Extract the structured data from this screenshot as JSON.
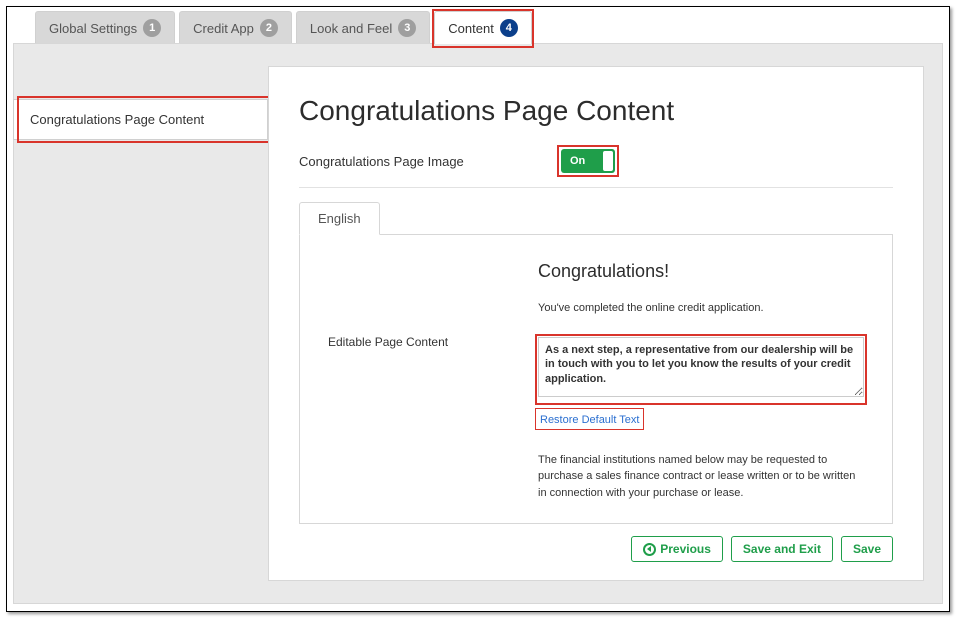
{
  "tabs": [
    {
      "label": "Global Settings",
      "num": "1"
    },
    {
      "label": "Credit App",
      "num": "2"
    },
    {
      "label": "Look and Feel",
      "num": "3"
    },
    {
      "label": "Content",
      "num": "4"
    }
  ],
  "sidebar": {
    "item": "Congratulations Page Content"
  },
  "page": {
    "title": "Congratulations Page Content",
    "image_toggle_label": "Congratulations Page Image",
    "toggle_state": "On"
  },
  "lang_tab": "English",
  "editor": {
    "left_label": "Editable Page Content",
    "heading": "Congratulations!",
    "intro": "You've completed the online credit application.",
    "body": "As a next step, a representative from our dealership will be in touch with you to let you know the results of your credit application.",
    "restore": "Restore Default Text",
    "footer": "The financial institutions named below may be requested to purchase a sales finance contract or lease written or to be written in connection with your purchase or lease."
  },
  "actions": {
    "previous": "Previous",
    "save_exit": "Save and Exit",
    "save": "Save"
  }
}
